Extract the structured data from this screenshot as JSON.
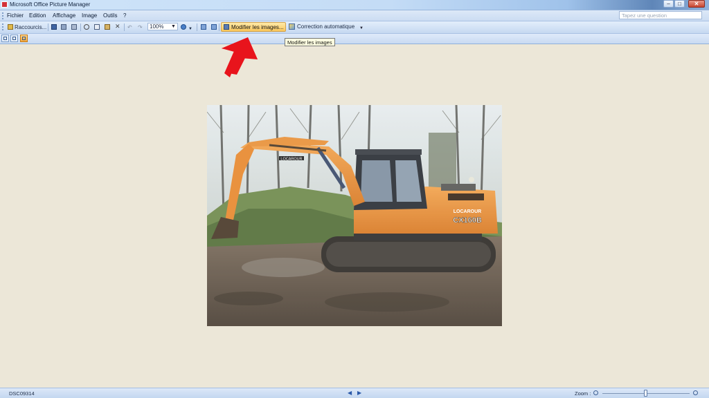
{
  "window": {
    "title": "Microsoft Office Picture Manager",
    "controls": {
      "minimize": "–",
      "restore": "□",
      "close": "✕"
    }
  },
  "menubar": {
    "items": [
      {
        "label": "Fichier"
      },
      {
        "label": "Edition"
      },
      {
        "label": "Affichage"
      },
      {
        "label": "Image"
      },
      {
        "label": "Outils"
      },
      {
        "label": "?"
      }
    ],
    "help_placeholder": "Tapez une question"
  },
  "toolbar": {
    "shortcuts_label": "Raccourcis...",
    "zoom_value": "100%",
    "edit_pictures_label": "Modifier les images...",
    "auto_correct_label": "Correction automatique"
  },
  "tooltip": {
    "text": "Modifier les images"
  },
  "photo": {
    "machine_brand": "LOCAROUR",
    "machine_model": "CX160B"
  },
  "statusbar": {
    "filename": "DSC09314",
    "zoom_label": "Zoom :"
  },
  "colors": {
    "workspace": "#ece7d8",
    "highlight": "#f9c65b",
    "annotation_arrow": "#e8141c",
    "excavator": "#e8892f"
  }
}
